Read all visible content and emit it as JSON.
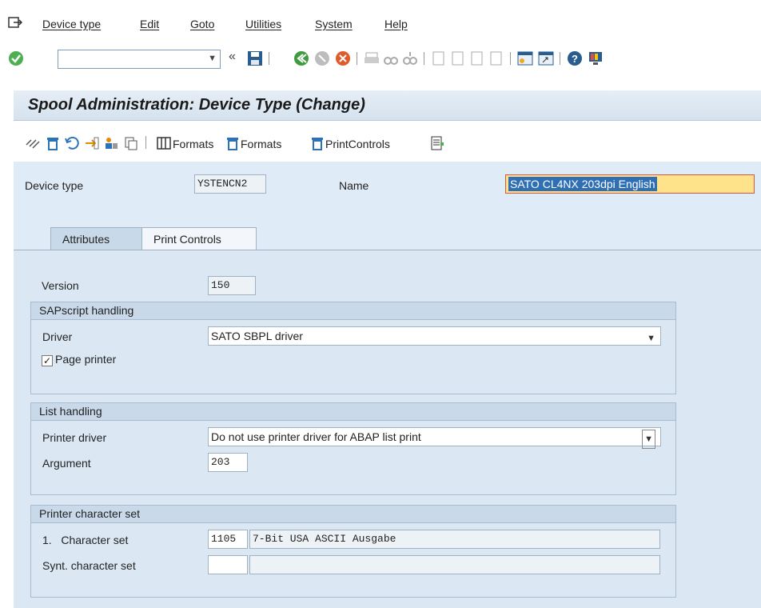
{
  "menu": {
    "items": [
      {
        "label": "Device type"
      },
      {
        "label": "Edit"
      },
      {
        "label": "Goto"
      },
      {
        "label": "Utilities"
      },
      {
        "label": "System"
      },
      {
        "label": "Help"
      }
    ]
  },
  "toolbar": {
    "command_value": "",
    "back_chevron": "«"
  },
  "title": "Spool Administration: Device Type (Change)",
  "app_toolbar": {
    "formats1_label": "Formats",
    "formats2_label": "Formats",
    "print_controls_label": "PrintControls"
  },
  "header": {
    "device_type_label": "Device type",
    "device_type_value": "YSTENCN2",
    "name_label": "Name",
    "name_value": "SATO CL4NX 203dpi English"
  },
  "tabs": [
    {
      "label": "Attributes",
      "active": true
    },
    {
      "label": "Print Controls",
      "active": false
    }
  ],
  "attributes": {
    "version_label": "Version",
    "version_value": "150",
    "sapscript": {
      "title": "SAPscript handling",
      "driver_label": "Driver",
      "driver_value": "SATO SBPL driver",
      "page_printer_label": "Page printer",
      "page_printer_checked": true
    },
    "list_handling": {
      "title": "List handling",
      "printer_driver_label": "Printer driver",
      "printer_driver_value": "Do not use printer driver for ABAP list print",
      "argument_label": "Argument",
      "argument_value": "203"
    },
    "charset": {
      "title": "Printer character set",
      "charset_label": "1.   Character set",
      "charset_code": "1105",
      "charset_desc": "7-Bit USA ASCII Ausgabe",
      "synt_label": "Synt. character set",
      "synt_code": "",
      "synt_desc": ""
    }
  },
  "colors": {
    "accent": "#0a6ed1",
    "panel_bg": "#dbe8f4",
    "highlight": "#ffe38a"
  }
}
